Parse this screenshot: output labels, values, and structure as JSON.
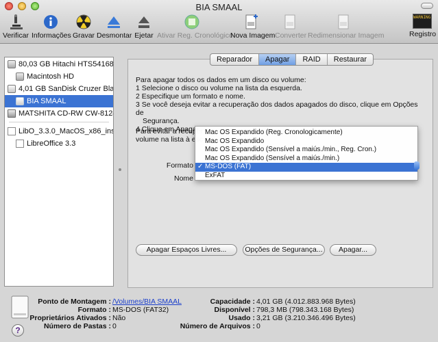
{
  "window": {
    "title": "BIA SMAAL"
  },
  "toolbar": {
    "verify": "Verificar",
    "info": "Informações",
    "burn": "Gravar",
    "unmount": "Desmontar",
    "eject": "Ejetar",
    "enable_journaling": "Ativar Reg. Cronológico",
    "new_image": "Nova Imagem",
    "convert": "Converter",
    "resize_image": "Redimensionar Imagem",
    "log": "Registro",
    "log_icon_text": "WARNING AY 7:36"
  },
  "sidebar": {
    "items": [
      {
        "label": "80,03 GB Hitachi HTS54168..."
      },
      {
        "label": "Macintosh HD"
      },
      {
        "label": "4,01 GB SanDisk Cruzer Bla..."
      },
      {
        "label": "BIA SMAAL"
      },
      {
        "label": "MATSHITA CD-RW CW-8124"
      },
      {
        "label": "LibO_3.3.0_MacOS_x86_inst..."
      },
      {
        "label": "LibreOffice 3.3"
      }
    ]
  },
  "tabs": [
    {
      "label": "Reparador"
    },
    {
      "label": "Apagar"
    },
    {
      "label": "RAID"
    },
    {
      "label": "Restaurar"
    }
  ],
  "erase": {
    "instructions": [
      "Para apagar todos os dados em um disco ou volume:",
      "1 Selecione o disco ou volume na lista da esquerda.",
      "2 Especifique um formato e nome.",
      "3 Se você deseja evitar a recuperação dos dados apagados do disco, clique em Opções de",
      "   Segurança.",
      "4 Clique em Apagar."
    ],
    "second_para_line1": "Para evitar a recuper",
    "second_para_line2": "volume na lista à esc",
    "format_label": "Formato",
    "name_label": "Nome",
    "format_options": [
      {
        "label": "Mac OS Expandido (Reg. Cronologicamente)"
      },
      {
        "label": "Mac OS Expandido"
      },
      {
        "label": "Mac OS Expandido (Sensível a maiús./min., Reg. Cron.)"
      },
      {
        "label": "Mac OS Expandido (Sensível a maiús./min.)"
      },
      {
        "label": "MS-DOS (FAT)"
      },
      {
        "label": "ExFAT"
      }
    ],
    "selected_check": "✓",
    "erase_free_space": "Apagar Espaços Livres...",
    "security_options": "Opções de Segurança...",
    "erase_button": "Apagar..."
  },
  "info": {
    "mount_point_label": "Ponto de Montagem :",
    "mount_point_value": "/Volumes/BIA SMAAL",
    "format_label": "Formato :",
    "format_value": "MS-DOS (FAT32)",
    "owners_label": "Proprietários Ativados :",
    "owners_value": "Não",
    "folders_label": "Número de Pastas :",
    "folders_value": "0",
    "capacity_label": "Capacidade :",
    "capacity_value": "4,01 GB (4.012.883.968 Bytes)",
    "available_label": "Disponível :",
    "available_value": "798,3 MB (798.343.168 Bytes)",
    "used_label": "Usado :",
    "used_value": "3,21 GB (3.210.346.496 Bytes)",
    "files_label": "Número de Arquivos :",
    "files_value": "0",
    "help": "?"
  },
  "colors": {
    "selection": "#3b73d3",
    "link": "#1a3ecb",
    "tab_active": "#6f9ee4"
  }
}
